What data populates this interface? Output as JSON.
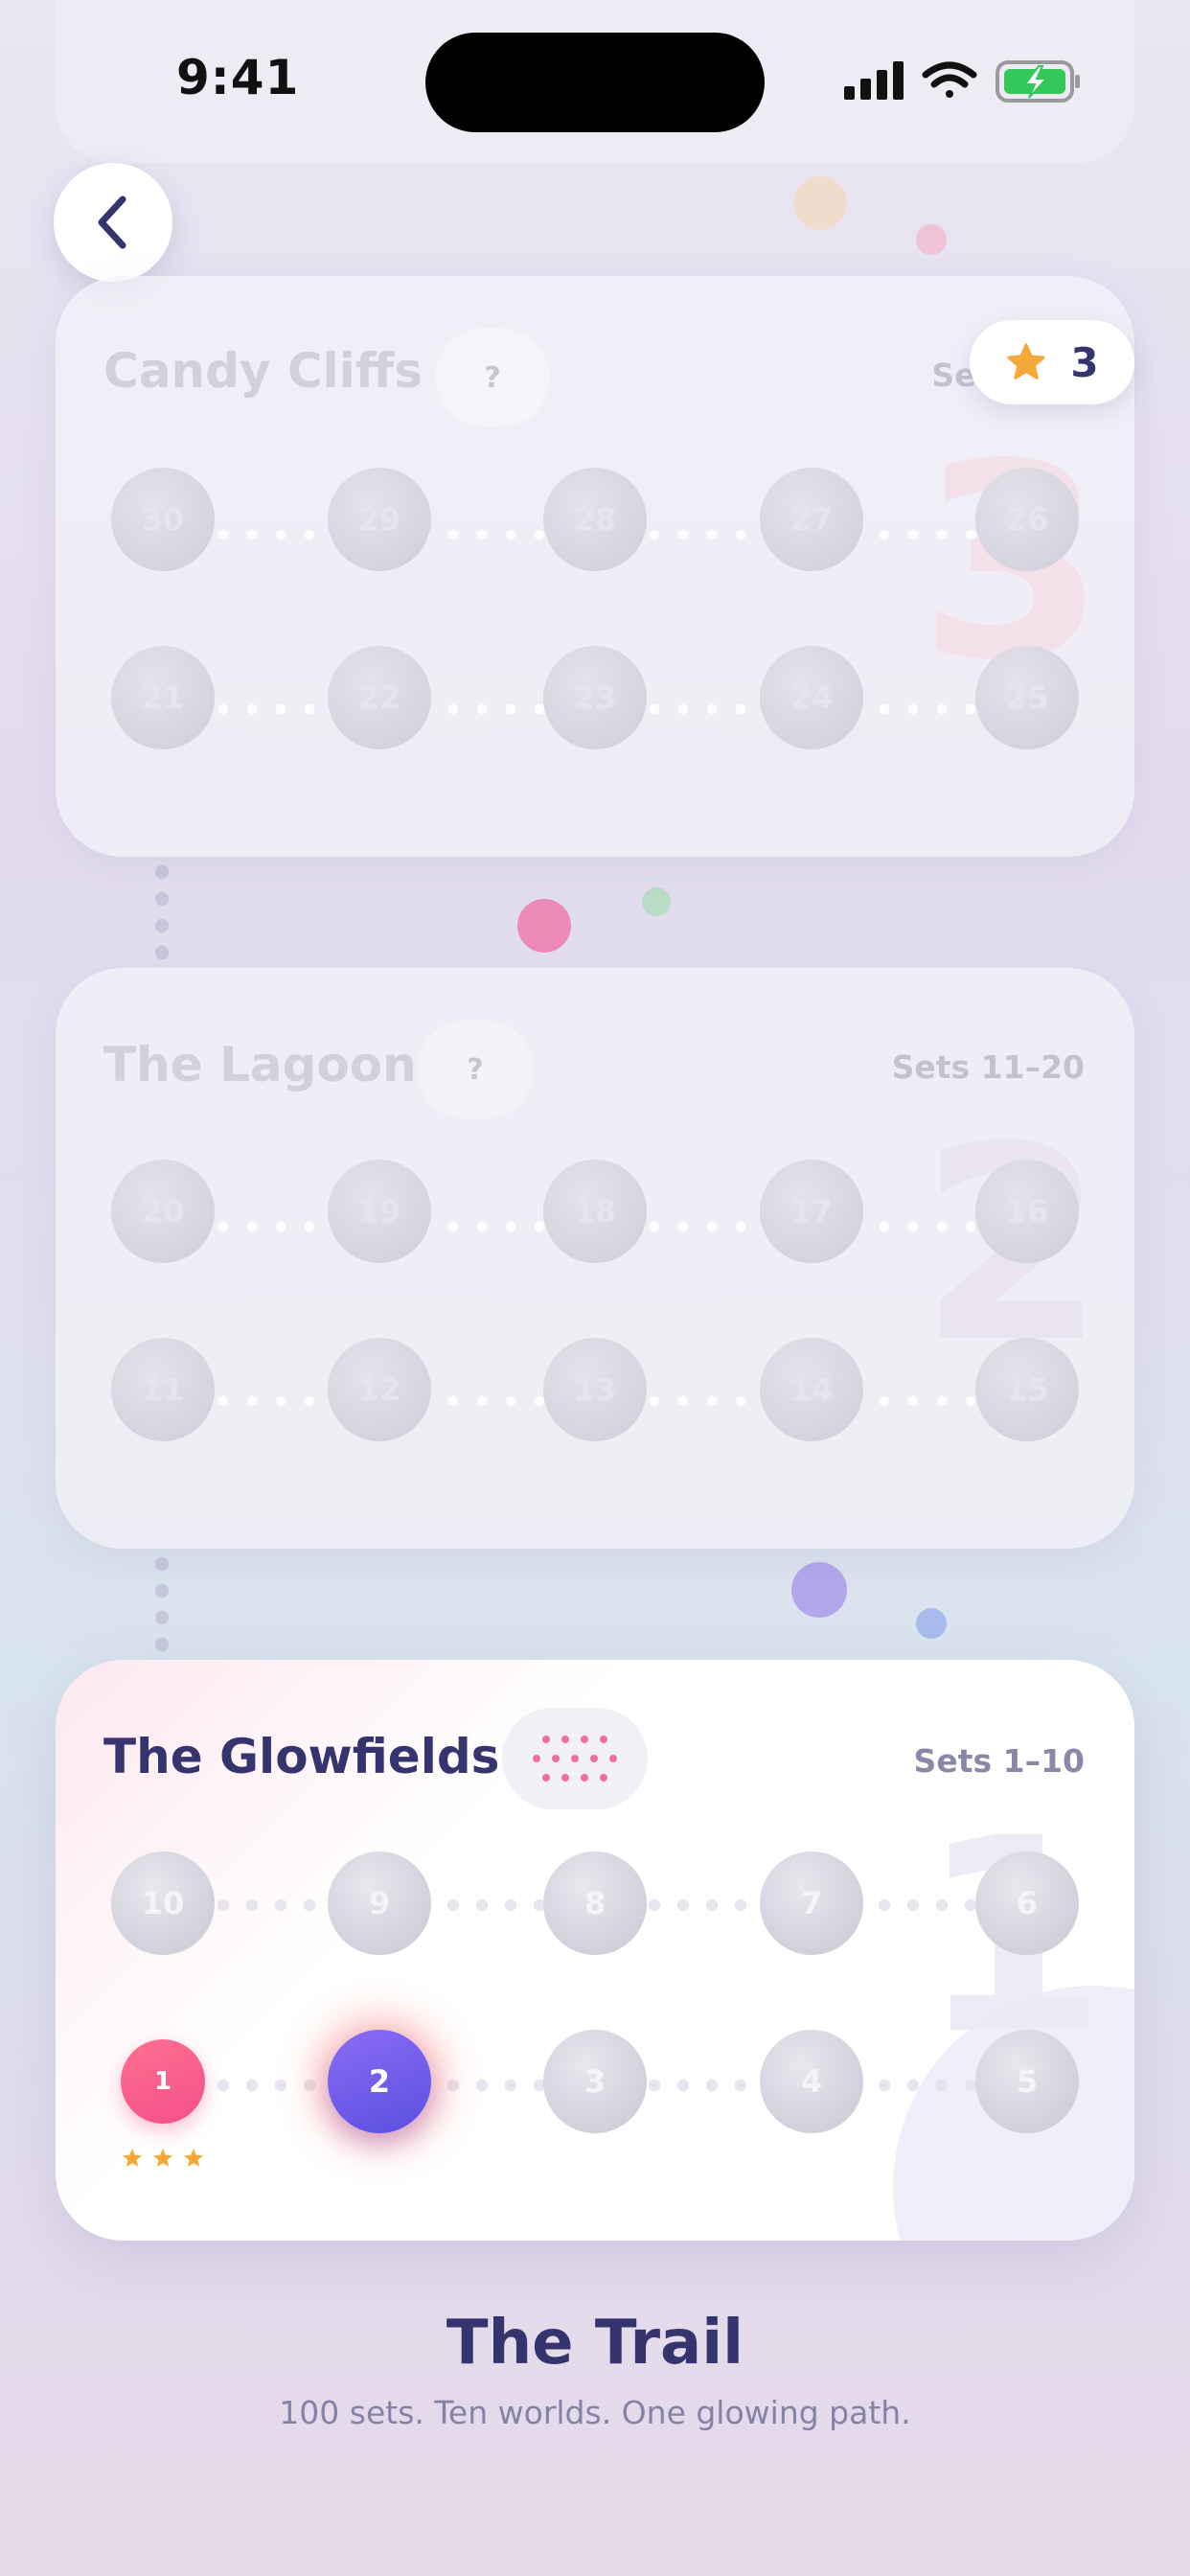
{
  "status_bar": {
    "time": "9:41"
  },
  "header": {
    "back_label": "Back",
    "stars": "3"
  },
  "worlds": [
    {
      "name": "Candy Cliffs",
      "range": "Sets",
      "help": "?",
      "number": "3",
      "top_row": [
        "30",
        "29",
        "28",
        "27",
        "26"
      ],
      "bottom_row": [
        "21",
        "22",
        "23",
        "24",
        "25"
      ]
    },
    {
      "name": "The Lagoon",
      "range": "Sets 11–20",
      "help": "?",
      "number": "2",
      "top_row": [
        "20",
        "19",
        "18",
        "17",
        "16"
      ],
      "bottom_row": [
        "11",
        "12",
        "13",
        "14",
        "15"
      ]
    },
    {
      "name": "The Glowfields",
      "range": "Sets 1–10",
      "number": "1",
      "top_row": [
        "10",
        "9",
        "8",
        "7",
        "6"
      ],
      "bottom_row": [
        "1",
        "2",
        "3",
        "4",
        "5"
      ]
    }
  ],
  "progress": {
    "completed_level": "1",
    "completed_stars": 3,
    "current_level": "2"
  },
  "footer": {
    "title": "The Trail",
    "subtitle": "100 sets. Ten worlds. One glowing path."
  },
  "colors": {
    "ink": "#36346e",
    "star": "#f6a93b",
    "done": "#f3508a",
    "current": "#5a4fe0"
  }
}
